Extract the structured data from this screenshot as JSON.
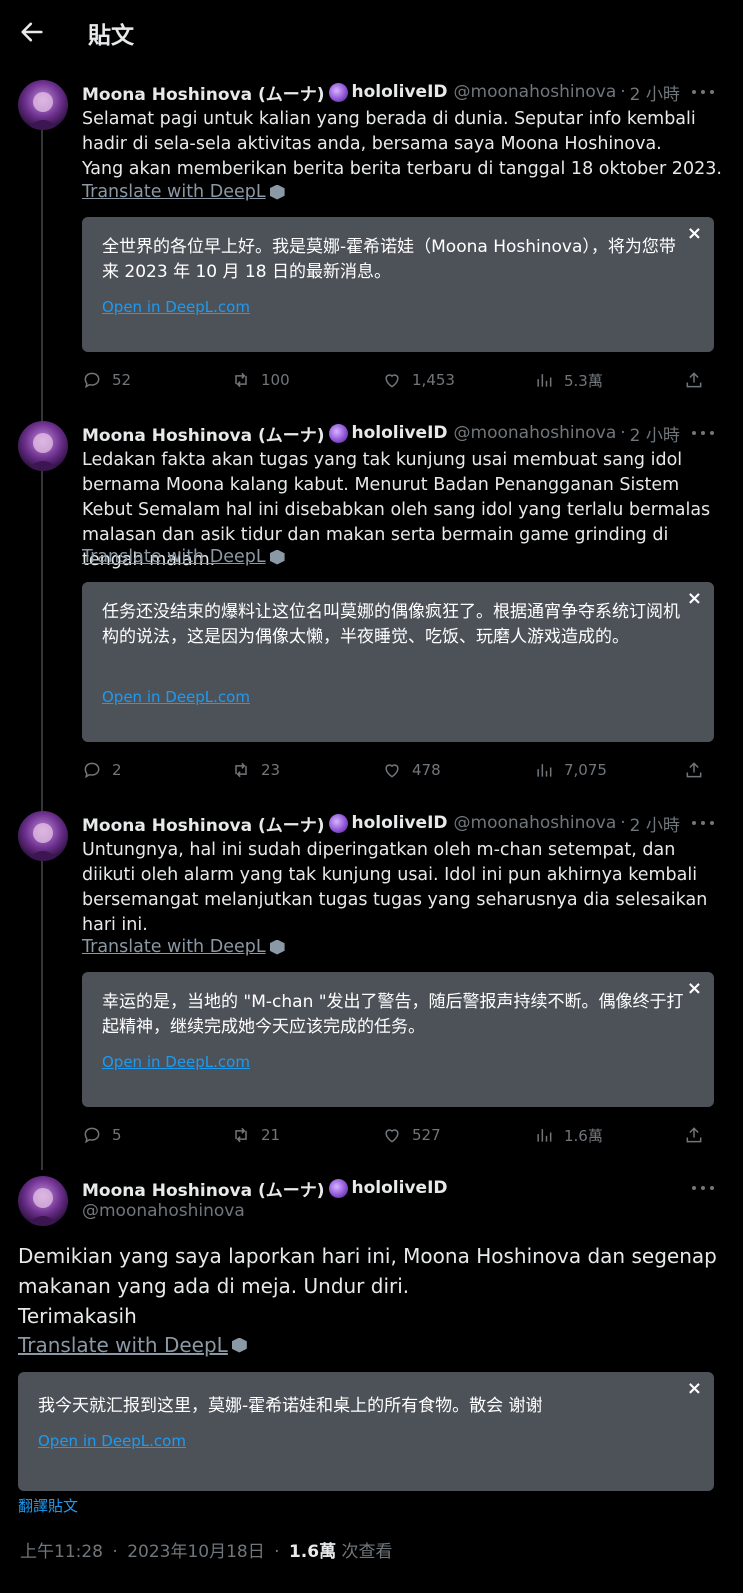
{
  "header": {
    "title": "貼文"
  },
  "author": {
    "name": "Moona Hoshinova (ムーナ)",
    "org": "hololiveID",
    "handle": "@moonahoshinova",
    "time": "2 小時"
  },
  "translate_label": "Translate with DeepL",
  "open_deepl_label": "Open in DeepL.com",
  "close_symbol": "×",
  "sep": "·",
  "posts": [
    {
      "text": "Selamat pagi untuk kalian yang berada di dunia. Seputar info kembali hadir di sela-sela aktivitas anda, bersama saya Moona Hoshinova.\nYang akan memberikan berita berita terbaru di tanggal 18 oktober 2023.",
      "translation": "全世界的各位早上好。我是莫娜-霍希诺娃（Moona Hoshinova），将为您带来 2023 年 10 月 18 日的最新消息。",
      "replies": "52",
      "reposts": "100",
      "likes": "1,453",
      "views": "5.3萬"
    },
    {
      "text": "Ledakan fakta akan tugas yang tak kunjung usai membuat sang idol bernama Moona kalang kabut. Menurut Badan Penangganan Sistem Kebut Semalam hal ini disebabkan oleh sang idol yang terlalu bermalas malasan dan asik tidur dan makan serta bermain game grinding di tengah malam.",
      "translation": "任务还没结束的爆料让这位名叫莫娜的偶像疯狂了。根据通宵争夺系统订阅机构的说法，这是因为偶像太懒，半夜睡觉、吃饭、玩磨人游戏造成的。",
      "replies": "2",
      "reposts": "23",
      "likes": "478",
      "views": "7,075"
    },
    {
      "text": "Untungnya, hal ini sudah diperingatkan oleh m-chan setempat, dan diikuti oleh alarm yang tak kunjung usai. Idol ini pun akhirnya kembali bersemangat melanjutkan tugas tugas yang seharusnya dia selesaikan hari ini.",
      "translation": "幸运的是，当地的 \"M-chan \"发出了警告，随后警报声持续不断。偶像终于打起精神，继续完成她今天应该完成的任务。",
      "replies": "5",
      "reposts": "21",
      "likes": "527",
      "views": "1.6萬"
    }
  ],
  "main_post": {
    "text": "Demikian yang saya laporkan hari ini, Moona Hoshinova dan segenap makanan yang ada di meja. Undur diri.\nTerimakasih",
    "translation": "我今天就汇报到这里，莫娜-霍希诺娃和桌上的所有食物。散会 谢谢",
    "translate_post_label": "翻譯貼文",
    "time": "上午11:28",
    "date": "2023年10月18日",
    "views": "1.6萬",
    "views_label": "次查看"
  },
  "colors": {
    "background": "#000000",
    "card": "#4d5259",
    "link": "#1d9bf0",
    "muted": "#71767b"
  },
  "icons": [
    "back-arrow-icon",
    "moon-emoji-icon",
    "more-icon",
    "deepl-icon",
    "close-icon",
    "reply-icon",
    "repost-icon",
    "like-icon",
    "views-icon",
    "share-icon"
  ]
}
